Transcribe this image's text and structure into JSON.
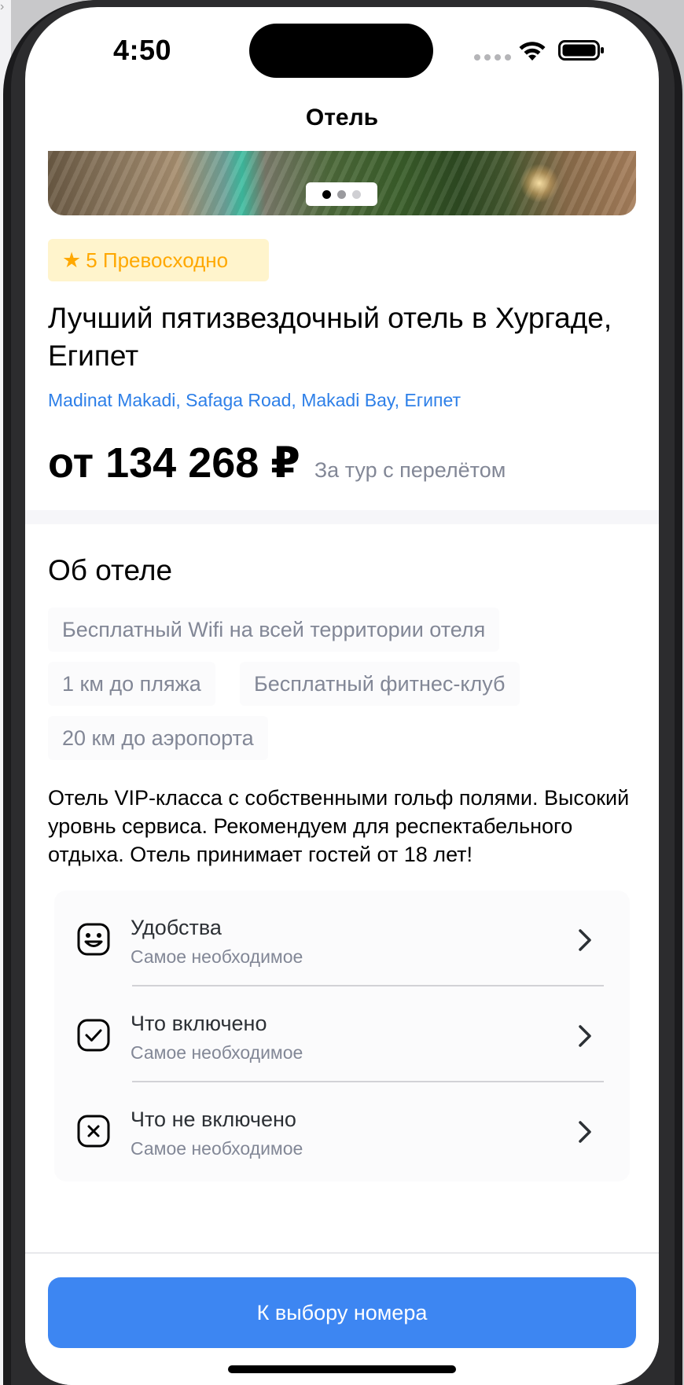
{
  "status_bar": {
    "time": "4:50"
  },
  "nav": {
    "title": "Отель"
  },
  "gallery": {
    "pages": 3,
    "active_page": 1
  },
  "hotel": {
    "rating": "5 Превосходно",
    "name": "Лучший пятизвездочный отель в Хургаде, Египет",
    "address": "Madinat Makadi, Safaga Road, Makadi Bay, Египет",
    "price": "от 134 268 ₽",
    "price_note": "За тур с перелётом"
  },
  "about": {
    "title": "Об отеле",
    "chips": [
      "Бесплатный Wifi на всей территории отеля",
      "1 км до пляжа",
      "Бесплатный фитнес-клуб",
      "20 км до аэропорта"
    ],
    "description": "Отель VIP-класса с собственными гольф полями. Высокий уровнь сервиса. Рекомендуем для респектабельного отдыха. Отель принимает гостей от 18 лет!"
  },
  "features": [
    {
      "title": "Удобства",
      "subtitle": "Самое необходимое",
      "icon": "emoji-happy-icon"
    },
    {
      "title": "Что включено",
      "subtitle": "Самое необходимое",
      "icon": "tick-square-icon"
    },
    {
      "title": "Что не включено",
      "subtitle": "Самое необходимое",
      "icon": "close-square-icon"
    }
  ],
  "cta": {
    "label": "К выбору номера"
  },
  "colors": {
    "accent": "#3d86f2",
    "link": "#2d7fe8",
    "rating_bg": "#fff4cc",
    "rating_text": "#ffa800",
    "muted_text": "#828796"
  }
}
